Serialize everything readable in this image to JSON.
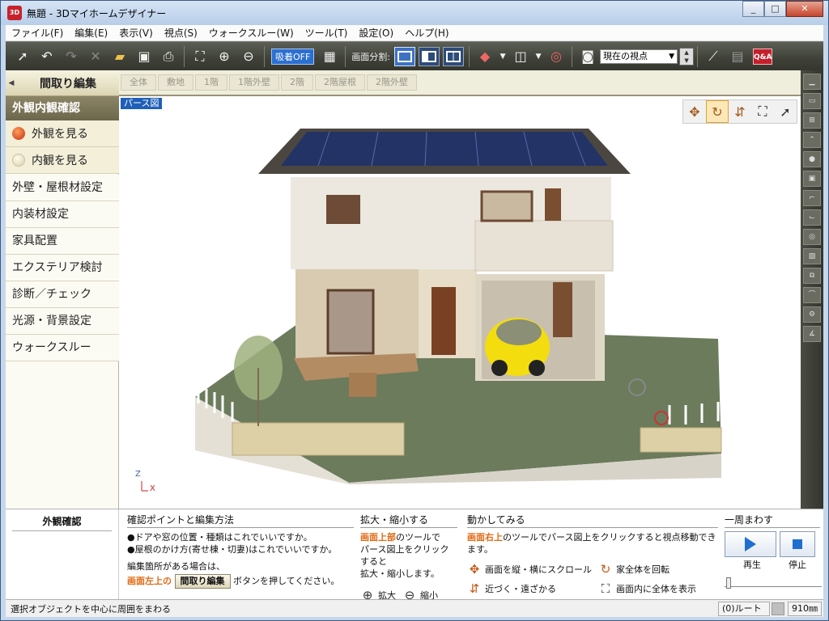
{
  "window": {
    "title": "無題 - 3Dマイホームデザイナー",
    "app_icon_text": "3D"
  },
  "menubar": [
    "ファイル(F)",
    "編集(E)",
    "表示(V)",
    "視点(S)",
    "ウォークスルー(W)",
    "ツール(T)",
    "設定(O)",
    "ヘルプ(H)"
  ],
  "toolbar": {
    "snap_label": "吸着OFF",
    "split_label": "画面分割:",
    "viewpoint_select": "現在の視点",
    "qa_label": "Q&A"
  },
  "leftpanel": {
    "edit_button": "間取り編集",
    "section_header": "外観内観確認",
    "radio_items": [
      {
        "label": "外観を見る",
        "selected": true
      },
      {
        "label": "内観を見る",
        "selected": false
      }
    ],
    "menu_items": [
      "外壁・屋根材設定",
      "内装材設定",
      "家具配置",
      "エクステリア検討",
      "診断／チェック",
      "光源・背景設定",
      "ウォークスルー"
    ]
  },
  "floortabs": [
    "全体",
    "敷地",
    "1階",
    "1階外壁",
    "2階",
    "2階屋根",
    "2階外壁"
  ],
  "viewport": {
    "label": "パース図",
    "axis_z": "Z",
    "axis_x": "X"
  },
  "help": {
    "side_title": "外観確認",
    "col1": {
      "heading": "確認ポイントと編集方法",
      "line1": "●ドアや窓の位置・種類はこれでいいですか。",
      "line2": "●屋根のかけ方(寄せ棟・切妻)はこれでいいですか。",
      "line3": "編集箇所がある場合は、",
      "highlight": "画面左上の",
      "button": "間取り編集",
      "line4": "ボタンを押してください。"
    },
    "col2": {
      "heading": "拡大・縮小する",
      "highlight": "画面上部",
      "text1": "のツールで",
      "text2": "パース図上をクリックすると",
      "text3": "拡大・縮小します。",
      "zoom_in": "拡大",
      "zoom_out": "縮小"
    },
    "col3": {
      "heading": "動かしてみる",
      "highlight": "画面右上",
      "text": "のツールでパース図上をクリックすると視点移動できます。",
      "scroll": "画面を縦・横にスクロール",
      "rotate": "家全体を回転",
      "approach": "近づく・遠ざかる",
      "fit": "画面内に全体を表示"
    },
    "col4": {
      "heading": "一周まわす",
      "play": "再生",
      "stop": "停止"
    }
  },
  "statusbar": {
    "text": "選択オブジェクトを中心に周囲をまわる",
    "route": "(0)ルート",
    "scale": "910㎜"
  },
  "colors": {
    "accent_orange": "#e06812",
    "selection_blue": "#1f5fb8"
  }
}
